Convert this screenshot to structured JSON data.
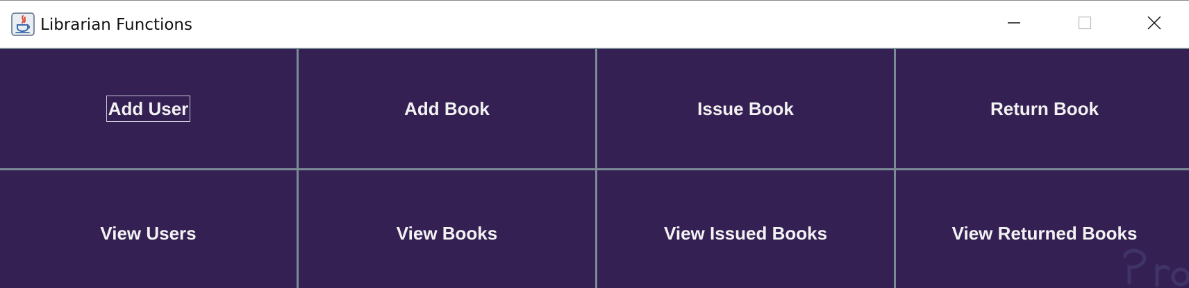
{
  "window": {
    "title": "Librarian Functions",
    "app_icon": "java-icon",
    "controls": {
      "minimize_icon": "minimize-icon",
      "maximize_icon": "maximize-icon",
      "close_icon": "close-icon"
    }
  },
  "colors": {
    "button_background": "#352054",
    "grid_lines": "#7b8b95",
    "button_text": "#f2f2f2"
  },
  "buttons": [
    {
      "label": "Add User",
      "focused": true
    },
    {
      "label": "Add Book",
      "focused": false
    },
    {
      "label": "Issue Book",
      "focused": false
    },
    {
      "label": "Return Book",
      "focused": false
    },
    {
      "label": "View Users",
      "focused": false
    },
    {
      "label": "View Books",
      "focused": false
    },
    {
      "label": "View Issued Books",
      "focused": false
    },
    {
      "label": "View Returned Books",
      "focused": false
    }
  ]
}
